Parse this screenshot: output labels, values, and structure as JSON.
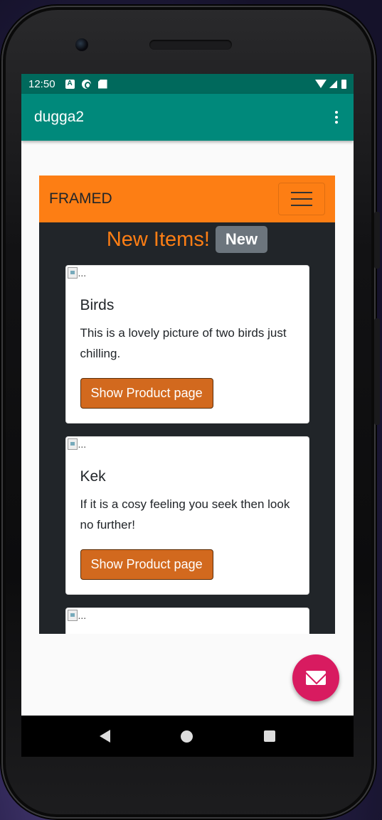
{
  "status_bar": {
    "time": "12:50"
  },
  "app_bar": {
    "title": "dugga2",
    "menu_icon": "overflow-menu-icon"
  },
  "web": {
    "brand": "FRAMED",
    "heading": "New Items!",
    "badge": "New",
    "image_alt": "...",
    "cards": [
      {
        "title": "Birds",
        "text": "This is a lovely picture of two birds just chilling.",
        "button": "Show Product page"
      },
      {
        "title": "Kek",
        "text": "If it is a cosy feeling you seek then look no further!",
        "button": "Show Product page"
      }
    ],
    "colors": {
      "navbar": "#fd7e14",
      "background": "#212529",
      "button": "#d2691e",
      "badge": "#6c757d"
    }
  },
  "fab": {
    "icon": "mail-icon"
  },
  "colors": {
    "status_bar": "#00695c",
    "app_bar": "#00897b",
    "fab": "#d81b60"
  }
}
